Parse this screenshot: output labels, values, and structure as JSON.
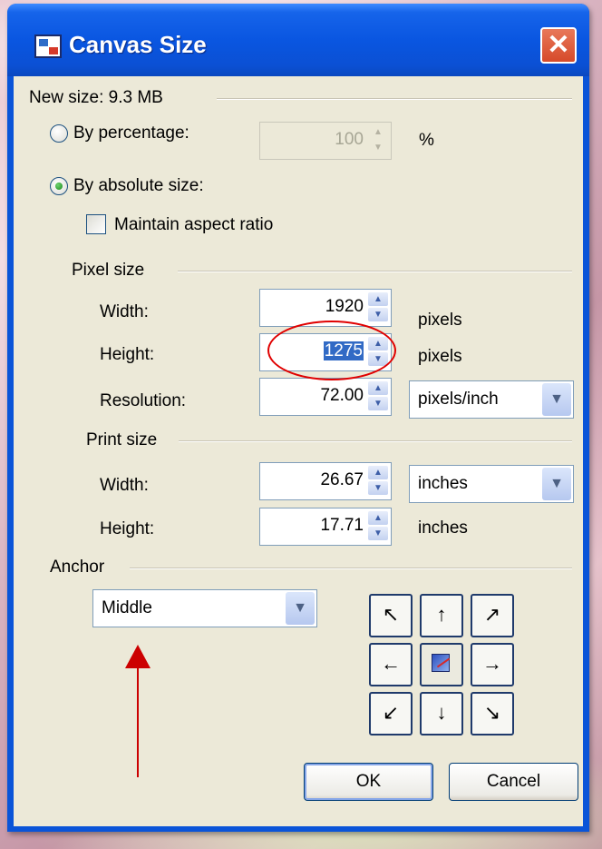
{
  "dialog": {
    "title": "Canvas Size",
    "close_glyph": "✕"
  },
  "new_size": {
    "label": "New size: 9.3 MB"
  },
  "by_percentage": {
    "label": "By percentage:",
    "value": "100",
    "unit": "%",
    "selected": false,
    "enabled": false
  },
  "by_absolute": {
    "label": "By absolute size:",
    "selected": true
  },
  "maintain_aspect": {
    "label": "Maintain aspect ratio",
    "checked": false
  },
  "pixel_size": {
    "header": "Pixel size",
    "width_label": "Width:",
    "width_value": "1920",
    "width_unit": "pixels",
    "height_label": "Height:",
    "height_value": "1275",
    "height_unit": "pixels",
    "resolution_label": "Resolution:",
    "resolution_value": "72.00",
    "resolution_unit": "pixels/inch"
  },
  "print_size": {
    "header": "Print size",
    "width_label": "Width:",
    "width_value": "26.67",
    "width_unit": "inches",
    "height_label": "Height:",
    "height_value": "17.71",
    "height_unit": "inches"
  },
  "anchor": {
    "header": "Anchor",
    "selected": "Middle",
    "grid": [
      "↖",
      "↑",
      "↗",
      "←",
      "",
      "→",
      "↙",
      "↓",
      "↘"
    ]
  },
  "buttons": {
    "ok": "OK",
    "cancel": "Cancel"
  },
  "spin_glyphs": {
    "up": "▲",
    "down": "▼",
    "drop": "▼"
  },
  "colors": {
    "title_bar": "#0a56e1",
    "client_bg": "#ece9d8",
    "selection": "#316ac5",
    "annotation": "#e00000"
  }
}
